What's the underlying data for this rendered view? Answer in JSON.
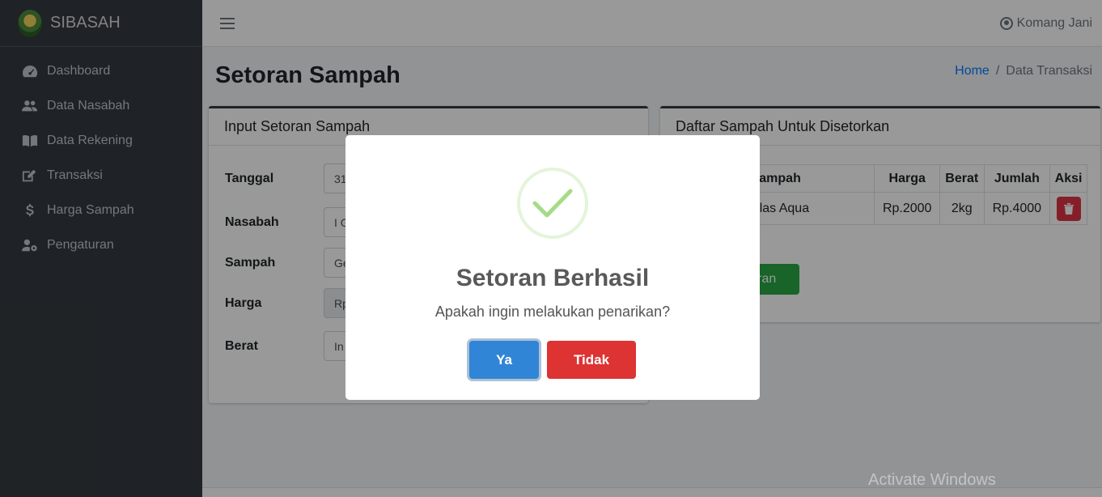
{
  "sidebar": {
    "brand": "SIBASAH",
    "items": [
      {
        "label": "Dashboard",
        "icon": "dashboard-gauge-icon"
      },
      {
        "label": "Data Nasabah",
        "icon": "users-icon"
      },
      {
        "label": "Data Rekening",
        "icon": "book-icon"
      },
      {
        "label": "Transaksi",
        "icon": "edit-icon"
      },
      {
        "label": "Harga Sampah",
        "icon": "dollar-icon"
      },
      {
        "label": "Pengaturan",
        "icon": "user-cog-icon"
      }
    ]
  },
  "header": {
    "user_name": "Komang Jani"
  },
  "page": {
    "title": "Setoran Sampah",
    "breadcrumb_home": "Home",
    "breadcrumb_sep": "/",
    "breadcrumb_current": "Data Transaksi"
  },
  "form_card": {
    "title": "Input Setoran Sampah",
    "fields": [
      {
        "label": "Tanggal",
        "value": "31"
      },
      {
        "label": "Nasabah",
        "value": "I G"
      },
      {
        "label": "Sampah",
        "value": "Ge"
      },
      {
        "label": "Harga",
        "value": "Rp"
      },
      {
        "label": "Berat",
        "value": "In"
      }
    ]
  },
  "list_card": {
    "title": "Daftar Sampah Untuk Disetorkan",
    "columns": [
      "Sampah",
      "Harga",
      "Berat",
      "Jumlah",
      "Aksi"
    ],
    "rows": [
      {
        "sampah": "Gelas Aqua",
        "harga": "Rp.2000",
        "berat": "2kg",
        "jumlah": "Rp.4000"
      }
    ],
    "submit_label": "toran"
  },
  "modal": {
    "title": "Setoran Berhasil",
    "text": "Apakah ingin melakukan penarikan?",
    "confirm_label": "Ya",
    "cancel_label": "Tidak",
    "confirm_color": "#3085d6",
    "cancel_color": "#dd3333",
    "success_color": "#a5dc86"
  },
  "watermark": "Activate Windows"
}
